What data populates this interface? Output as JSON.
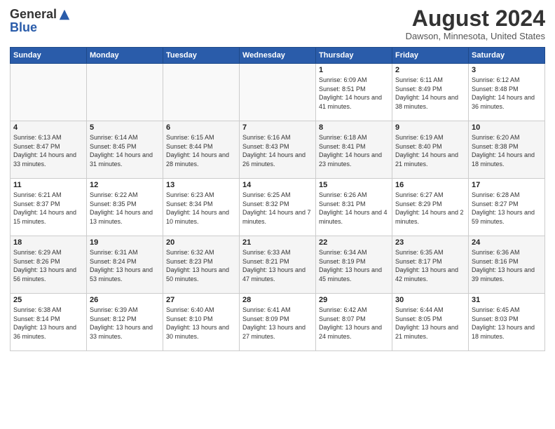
{
  "logo": {
    "general": "General",
    "blue": "Blue"
  },
  "header": {
    "month_year": "August 2024",
    "location": "Dawson, Minnesota, United States"
  },
  "days_of_week": [
    "Sunday",
    "Monday",
    "Tuesday",
    "Wednesday",
    "Thursday",
    "Friday",
    "Saturday"
  ],
  "weeks": [
    [
      {
        "day": "",
        "content": ""
      },
      {
        "day": "",
        "content": ""
      },
      {
        "day": "",
        "content": ""
      },
      {
        "day": "",
        "content": ""
      },
      {
        "day": "1",
        "content": "Sunrise: 6:09 AM\nSunset: 8:51 PM\nDaylight: 14 hours and 41 minutes."
      },
      {
        "day": "2",
        "content": "Sunrise: 6:11 AM\nSunset: 8:49 PM\nDaylight: 14 hours and 38 minutes."
      },
      {
        "day": "3",
        "content": "Sunrise: 6:12 AM\nSunset: 8:48 PM\nDaylight: 14 hours and 36 minutes."
      }
    ],
    [
      {
        "day": "4",
        "content": "Sunrise: 6:13 AM\nSunset: 8:47 PM\nDaylight: 14 hours and 33 minutes."
      },
      {
        "day": "5",
        "content": "Sunrise: 6:14 AM\nSunset: 8:45 PM\nDaylight: 14 hours and 31 minutes."
      },
      {
        "day": "6",
        "content": "Sunrise: 6:15 AM\nSunset: 8:44 PM\nDaylight: 14 hours and 28 minutes."
      },
      {
        "day": "7",
        "content": "Sunrise: 6:16 AM\nSunset: 8:43 PM\nDaylight: 14 hours and 26 minutes."
      },
      {
        "day": "8",
        "content": "Sunrise: 6:18 AM\nSunset: 8:41 PM\nDaylight: 14 hours and 23 minutes."
      },
      {
        "day": "9",
        "content": "Sunrise: 6:19 AM\nSunset: 8:40 PM\nDaylight: 14 hours and 21 minutes."
      },
      {
        "day": "10",
        "content": "Sunrise: 6:20 AM\nSunset: 8:38 PM\nDaylight: 14 hours and 18 minutes."
      }
    ],
    [
      {
        "day": "11",
        "content": "Sunrise: 6:21 AM\nSunset: 8:37 PM\nDaylight: 14 hours and 15 minutes."
      },
      {
        "day": "12",
        "content": "Sunrise: 6:22 AM\nSunset: 8:35 PM\nDaylight: 14 hours and 13 minutes."
      },
      {
        "day": "13",
        "content": "Sunrise: 6:23 AM\nSunset: 8:34 PM\nDaylight: 14 hours and 10 minutes."
      },
      {
        "day": "14",
        "content": "Sunrise: 6:25 AM\nSunset: 8:32 PM\nDaylight: 14 hours and 7 minutes."
      },
      {
        "day": "15",
        "content": "Sunrise: 6:26 AM\nSunset: 8:31 PM\nDaylight: 14 hours and 4 minutes."
      },
      {
        "day": "16",
        "content": "Sunrise: 6:27 AM\nSunset: 8:29 PM\nDaylight: 14 hours and 2 minutes."
      },
      {
        "day": "17",
        "content": "Sunrise: 6:28 AM\nSunset: 8:27 PM\nDaylight: 13 hours and 59 minutes."
      }
    ],
    [
      {
        "day": "18",
        "content": "Sunrise: 6:29 AM\nSunset: 8:26 PM\nDaylight: 13 hours and 56 minutes."
      },
      {
        "day": "19",
        "content": "Sunrise: 6:31 AM\nSunset: 8:24 PM\nDaylight: 13 hours and 53 minutes."
      },
      {
        "day": "20",
        "content": "Sunrise: 6:32 AM\nSunset: 8:23 PM\nDaylight: 13 hours and 50 minutes."
      },
      {
        "day": "21",
        "content": "Sunrise: 6:33 AM\nSunset: 8:21 PM\nDaylight: 13 hours and 47 minutes."
      },
      {
        "day": "22",
        "content": "Sunrise: 6:34 AM\nSunset: 8:19 PM\nDaylight: 13 hours and 45 minutes."
      },
      {
        "day": "23",
        "content": "Sunrise: 6:35 AM\nSunset: 8:17 PM\nDaylight: 13 hours and 42 minutes."
      },
      {
        "day": "24",
        "content": "Sunrise: 6:36 AM\nSunset: 8:16 PM\nDaylight: 13 hours and 39 minutes."
      }
    ],
    [
      {
        "day": "25",
        "content": "Sunrise: 6:38 AM\nSunset: 8:14 PM\nDaylight: 13 hours and 36 minutes."
      },
      {
        "day": "26",
        "content": "Sunrise: 6:39 AM\nSunset: 8:12 PM\nDaylight: 13 hours and 33 minutes."
      },
      {
        "day": "27",
        "content": "Sunrise: 6:40 AM\nSunset: 8:10 PM\nDaylight: 13 hours and 30 minutes."
      },
      {
        "day": "28",
        "content": "Sunrise: 6:41 AM\nSunset: 8:09 PM\nDaylight: 13 hours and 27 minutes."
      },
      {
        "day": "29",
        "content": "Sunrise: 6:42 AM\nSunset: 8:07 PM\nDaylight: 13 hours and 24 minutes."
      },
      {
        "day": "30",
        "content": "Sunrise: 6:44 AM\nSunset: 8:05 PM\nDaylight: 13 hours and 21 minutes."
      },
      {
        "day": "31",
        "content": "Sunrise: 6:45 AM\nSunset: 8:03 PM\nDaylight: 13 hours and 18 minutes."
      }
    ]
  ]
}
